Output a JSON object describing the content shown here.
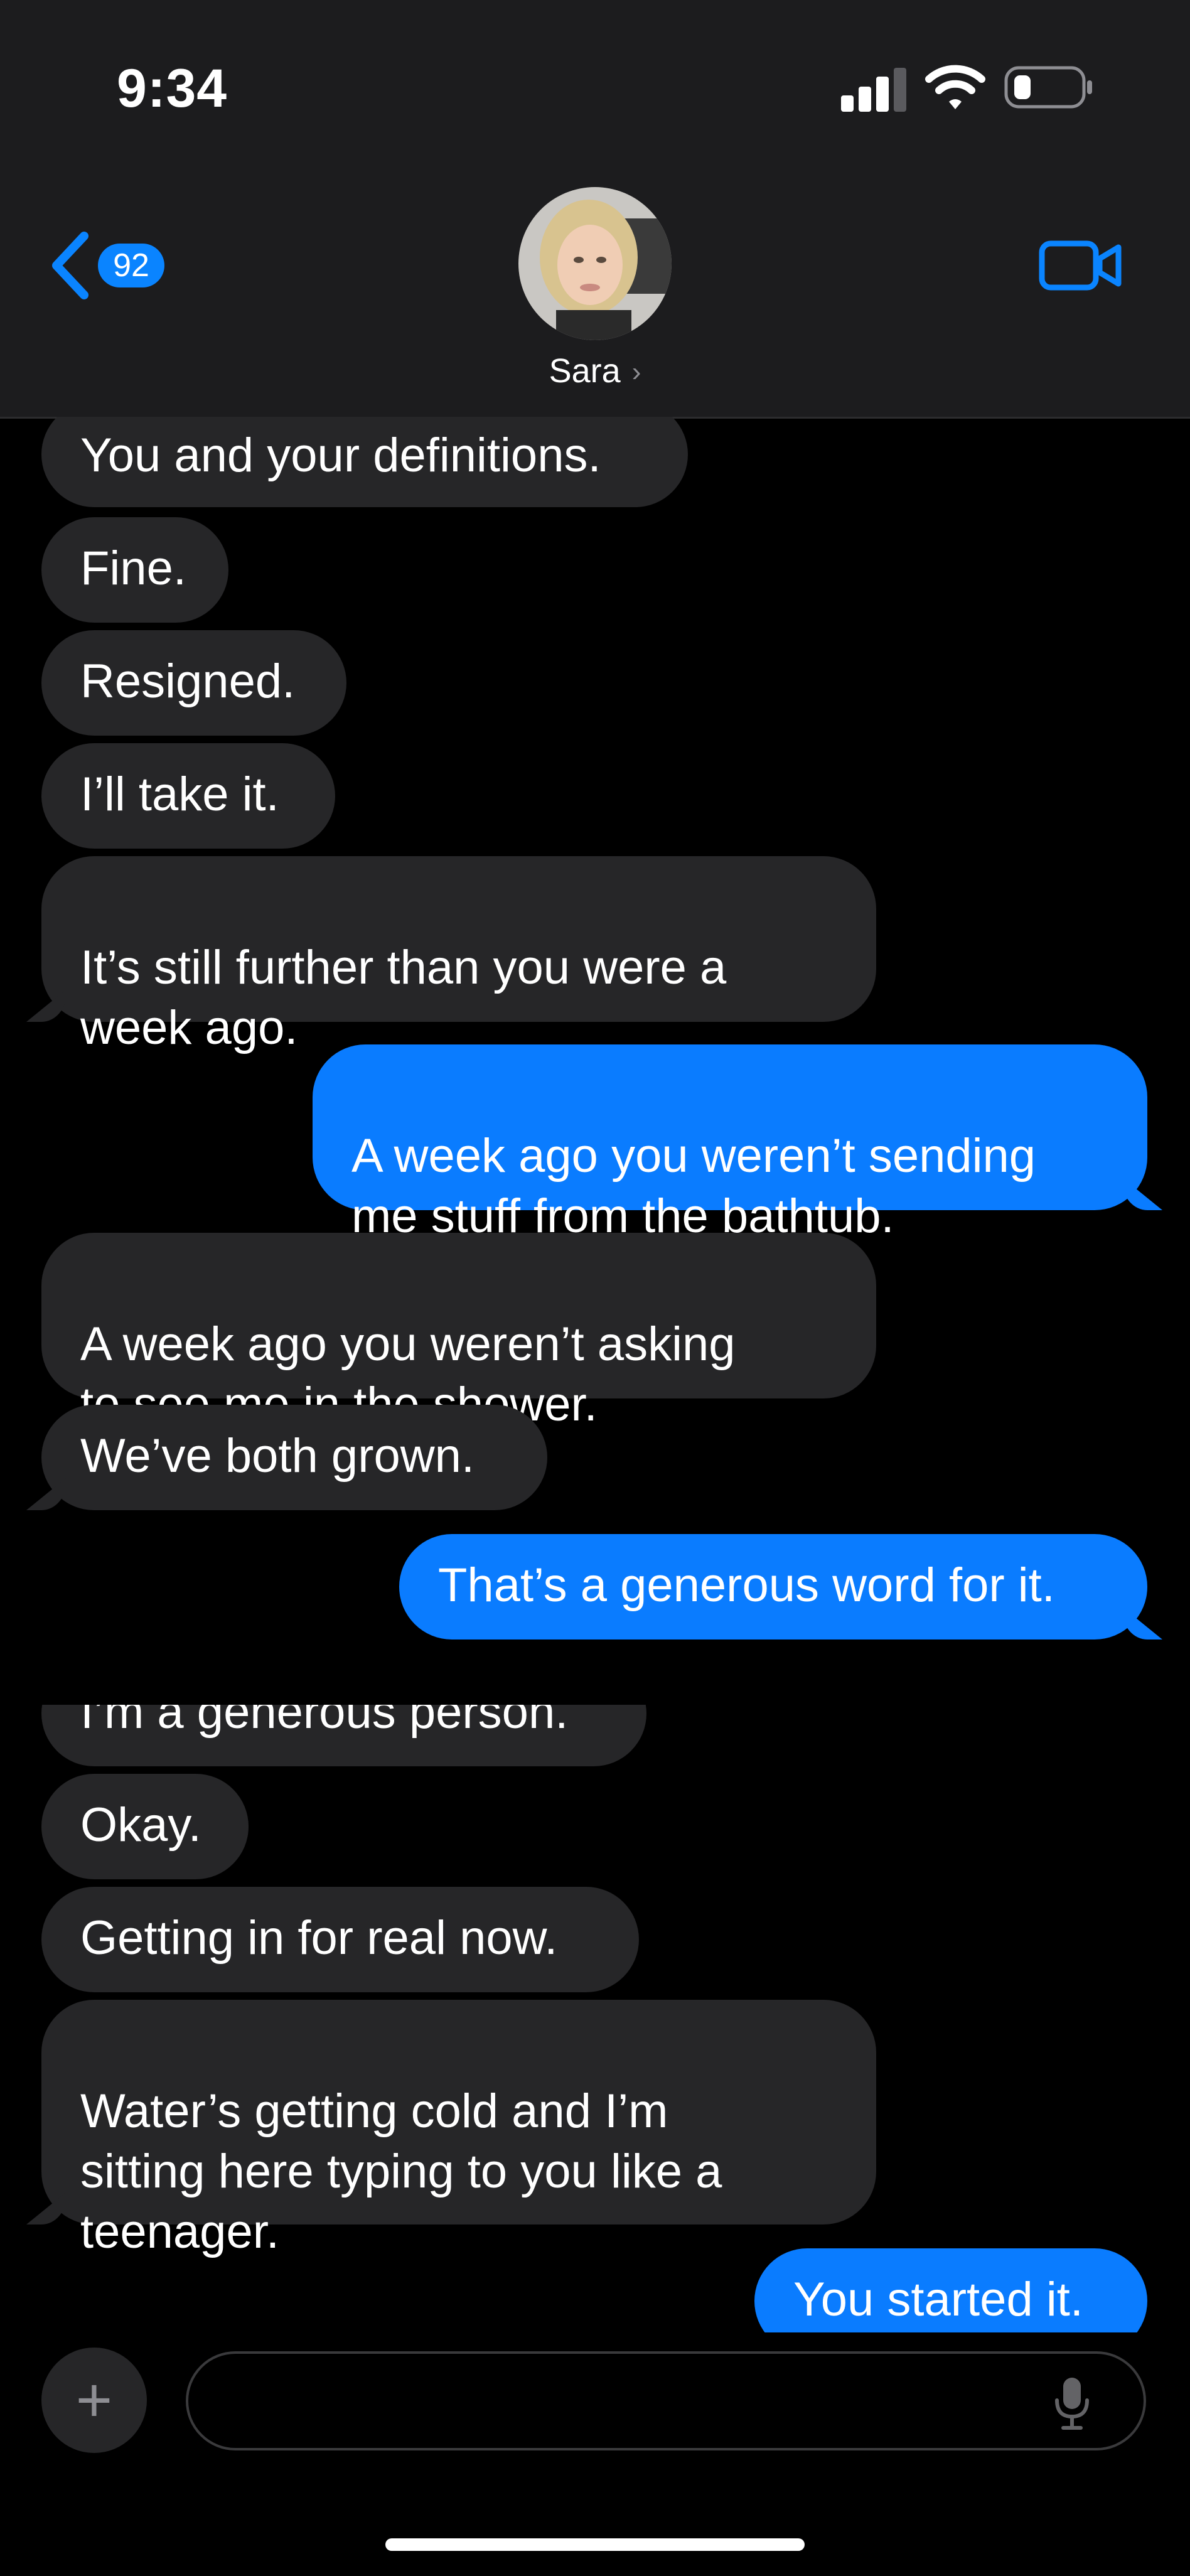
{
  "status_bar": {
    "time": "9:34"
  },
  "header": {
    "back_badge": "92",
    "contact_name": "Sara",
    "chevron": "›"
  },
  "messages": [
    {
      "dir": "in",
      "text": "You and your definitions."
    },
    {
      "dir": "in",
      "text": "Fine."
    },
    {
      "dir": "in",
      "text": "Resigned."
    },
    {
      "dir": "in",
      "text": "I’ll take it."
    },
    {
      "dir": "in",
      "text": "It’s still further than you were a\nweek ago."
    },
    {
      "dir": "out",
      "text": "A week ago you weren’t sending\nme stuff from the bathtub."
    },
    {
      "dir": "in",
      "text": "A week ago you weren’t asking\nto see me in the shower."
    },
    {
      "dir": "in",
      "text": "We’ve both grown."
    },
    {
      "dir": "out",
      "text": "That’s a generous word for it."
    },
    {
      "dir": "in",
      "text": "I’m a generous person."
    },
    {
      "dir": "in",
      "text": "Okay."
    },
    {
      "dir": "in",
      "text": "Getting in for real now."
    },
    {
      "dir": "in",
      "text": "Water’s getting cold and I’m\nsitting here typing to you like a\nteenager."
    },
    {
      "dir": "out",
      "text": "You started it."
    }
  ],
  "composer": {
    "plus": "+",
    "placeholder": ""
  },
  "colors": {
    "incoming_bubble": "#262628",
    "outgoing_bubble": "#0a7cff",
    "accent": "#0a84ff",
    "background": "#000000"
  },
  "icons": [
    "cellular-signal-icon",
    "wifi-icon",
    "battery-icon",
    "back-chevron-icon",
    "video-camera-icon",
    "plus-icon",
    "microphone-icon"
  ]
}
